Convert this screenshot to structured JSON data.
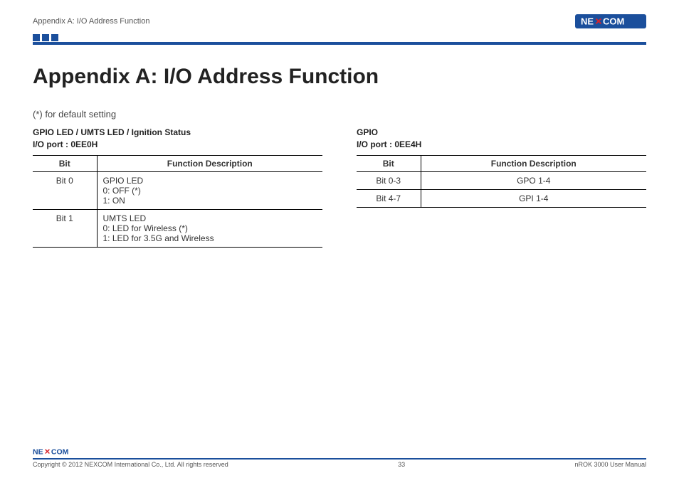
{
  "brand": "NEXCOM",
  "header": {
    "running_title": "Appendix A: I/O Address Function"
  },
  "title": "Appendix A: I/O Address Function",
  "default_note": "(*) for default setting",
  "left": {
    "heading": "GPIO LED / UMTS LED / Ignition Status\nI/O port : 0EE0H",
    "th_bit": "Bit",
    "th_func": "Function Description",
    "rows": [
      {
        "bit": "Bit 0",
        "func": "GPIO LED\n0: OFF (*)\n1: ON"
      },
      {
        "bit": "Bit 1",
        "func": "UMTS LED\n0: LED for Wireless (*)\n1: LED for 3.5G and Wireless"
      }
    ]
  },
  "right": {
    "heading": "GPIO\nI/O port : 0EE4H",
    "th_bit": "Bit",
    "th_func": "Function Description",
    "rows": [
      {
        "bit": "Bit 0-3",
        "func": "GPO 1-4"
      },
      {
        "bit": "Bit 4-7",
        "func": "GPI 1-4"
      }
    ]
  },
  "footer": {
    "copyright": "Copyright © 2012 NEXCOM International Co., Ltd. All rights reserved",
    "page": "33",
    "doc": "nROK 3000 User Manual"
  }
}
